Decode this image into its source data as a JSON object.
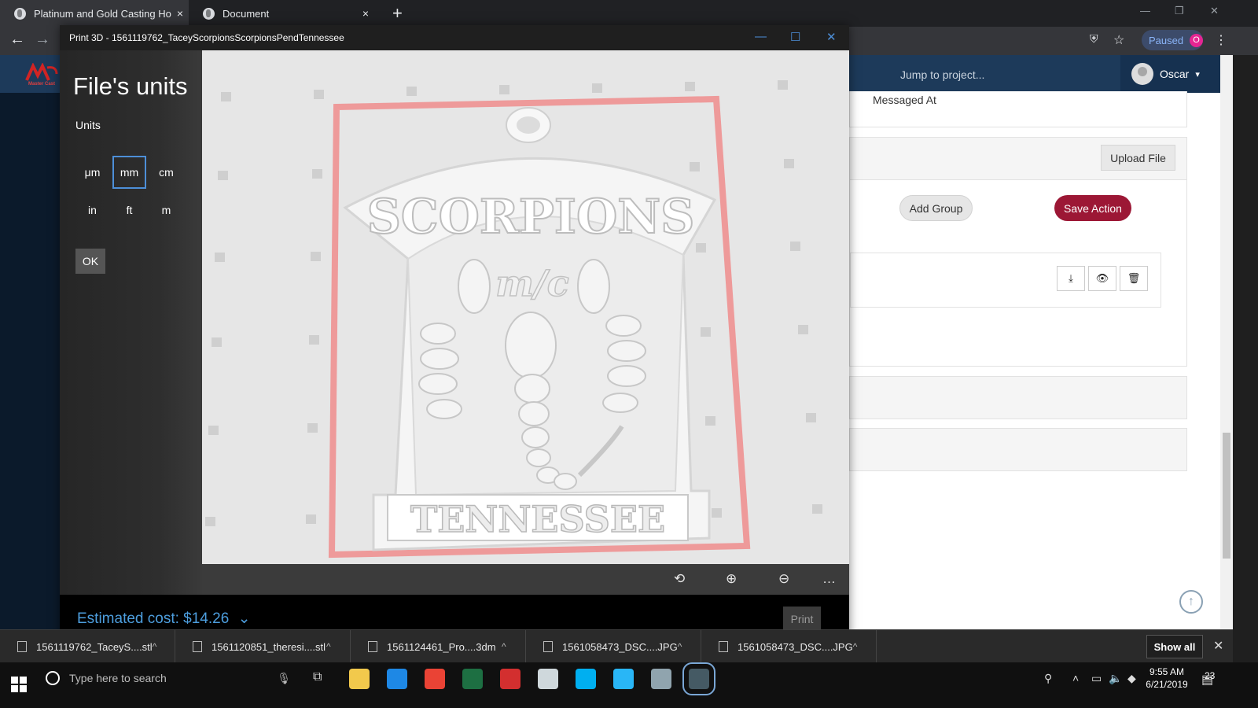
{
  "browser": {
    "tabs": [
      {
        "label": "Platinum and Gold Casting House",
        "close": "×"
      },
      {
        "label": "Document",
        "close": "×"
      }
    ],
    "new_tab": "+",
    "window_controls": {
      "minimize": "—",
      "restore": "❐",
      "close": "✕"
    },
    "nav": {
      "back": "←",
      "forward": "→"
    },
    "paused_label": "Paused",
    "paused_count": "O"
  },
  "webpage": {
    "logo_text": "Master Cast",
    "jump_placeholder": "Jump to project...",
    "user_name": "Oscar",
    "messaged_at_label": "Messaged At",
    "upload_file_label": "Upload File",
    "add_group_label": "Add Group",
    "save_action_label": "Save Action",
    "icon_buttons": {
      "download": "⤓",
      "view": "👁",
      "delete": "🗑"
    },
    "scroll_top": "↑"
  },
  "print3d": {
    "title": "Print 3D - 1561119762_TaceyScorpionsScorpionsPendTennessee",
    "window_controls": {
      "minimize": "—",
      "maximize": "☐",
      "close": "✕"
    },
    "heading": "File's units",
    "units_label": "Units",
    "units": [
      "μm",
      "mm",
      "cm",
      "in",
      "ft",
      "m"
    ],
    "selected_unit": "mm",
    "ok_label": "OK",
    "model": {
      "top_text": "SCORPIONS",
      "middle_text": "m/c",
      "bottom_text": "TENNESSEE"
    },
    "view_tools": {
      "orbit": "⟲",
      "zoom_in": "⊕",
      "zoom_out": "⊖",
      "more": "…"
    },
    "estimated_cost": "Estimated cost: $14.26",
    "cost_chevron": "⌄",
    "print_label": "Print"
  },
  "downloads": {
    "items": [
      "1561119762_TaceyS....stl",
      "1561120851_theresi....stl",
      "1561124461_Pro....3dm",
      "1561058473_DSC....JPG",
      "1561058473_DSC....JPG"
    ],
    "arrow": "^",
    "show_all_label": "Show all",
    "close": "✕"
  },
  "taskbar": {
    "search_placeholder": "Type here to search",
    "time": "9:55 AM",
    "date": "6/21/2019",
    "notification_count": "23",
    "app_colors": [
      "#f2c94c",
      "#1e88e5",
      "#ea4335",
      "#1d6f42",
      "#d32f2f",
      "#cfd8dc",
      "#00aff0",
      "#29b6f6",
      "#90a4ae",
      "#455a64"
    ]
  }
}
